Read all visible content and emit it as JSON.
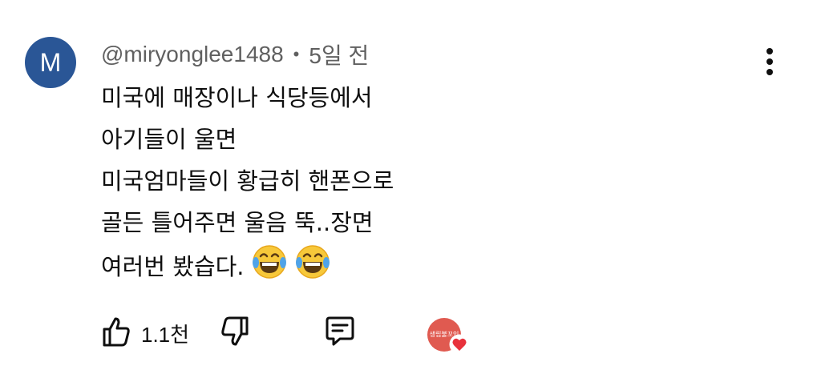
{
  "comment": {
    "avatar_initial": "M",
    "avatar_color": "#2a5696",
    "author": "@miryonglee1488",
    "separator": "•",
    "time": "5일 전",
    "lines": [
      "미국에 매장이나 식당등에서",
      "아기들이 울면",
      "미국엄마들이 황급히 핸폰으로",
      "골든 틀어주면 울음 뚝..장면",
      "여러번 봤습다."
    ],
    "emojis": [
      "face-with-tears-of-joy",
      "face-with-tears-of-joy"
    ]
  },
  "actions": {
    "like_count": "1.1천",
    "creator_avatar_text": "생립불꼬인"
  },
  "colors": {
    "text": "#0f0f0f",
    "meta": "#606060",
    "heart": "#e8323c",
    "creator_avatar": "#e05a50"
  }
}
